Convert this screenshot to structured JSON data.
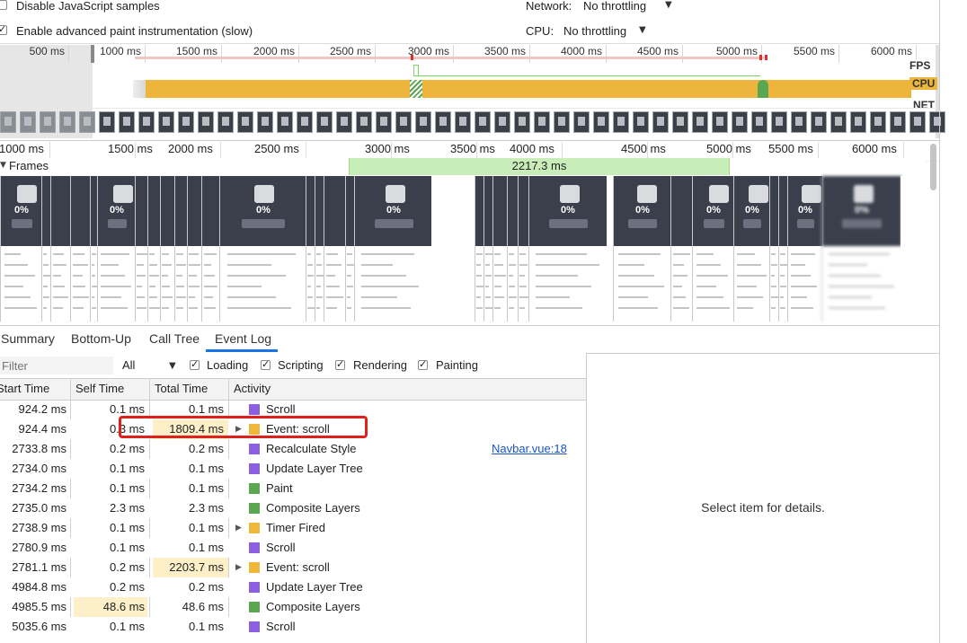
{
  "settings": {
    "disable_js_samples": {
      "label": "Disable JavaScript samples",
      "checked": false
    },
    "advanced_paint": {
      "label": "Enable advanced paint instrumentation (slow)",
      "checked": true
    },
    "network": {
      "label": "Network:",
      "value": "No throttling"
    },
    "cpu": {
      "label": "CPU:",
      "value": "No throttling"
    }
  },
  "overview": {
    "ticks": [
      "500 ms",
      "1000 ms",
      "1500 ms",
      "2000 ms",
      "2500 ms",
      "3000 ms",
      "3500 ms",
      "4000 ms",
      "4500 ms",
      "5000 ms",
      "5500 ms",
      "6000 ms"
    ],
    "track_labels": {
      "fps": "FPS",
      "cpu": "CPU",
      "net": "NET"
    }
  },
  "timeline": {
    "ticks": [
      "1000 ms",
      "1500 ms",
      "2000 ms",
      "2500 ms",
      "3000 ms",
      "3500 ms",
      "4000 ms",
      "4500 ms",
      "5000 ms",
      "5500 ms",
      "6000 ms"
    ],
    "frames_label": "Frames",
    "frame_duration": "2217.3 ms",
    "frame_percent": "0%"
  },
  "tabs": [
    {
      "label": "Summary",
      "active": false
    },
    {
      "label": "Bottom-Up",
      "active": false
    },
    {
      "label": "Call Tree",
      "active": false
    },
    {
      "label": "Event Log",
      "active": true
    }
  ],
  "filters": {
    "filter_placeholder": "Filter",
    "select_value": "All",
    "checks": [
      {
        "label": "Loading",
        "checked": true
      },
      {
        "label": "Scripting",
        "checked": true
      },
      {
        "label": "Rendering",
        "checked": true
      },
      {
        "label": "Painting",
        "checked": true
      }
    ]
  },
  "table": {
    "headers": [
      "Start Time",
      "Self Time",
      "Total Time",
      "Activity"
    ],
    "rows": [
      {
        "start": "924.2 ms",
        "self": "0.1 ms",
        "total": "0.1 ms",
        "activity": "Scroll",
        "color": "#8b5fe0",
        "expandable": false,
        "link": "",
        "total_highlight": false,
        "self_highlight": false
      },
      {
        "start": "924.4 ms",
        "self": "0.3 ms",
        "total": "1809.4 ms",
        "activity": "Event: scroll",
        "color": "#f0b73a",
        "expandable": true,
        "link": "",
        "total_highlight": true,
        "self_highlight": false
      },
      {
        "start": "2733.8 ms",
        "self": "0.2 ms",
        "total": "0.2 ms",
        "activity": "Recalculate Style",
        "color": "#8b5fe0",
        "expandable": false,
        "link": "Navbar.vue:18",
        "total_highlight": false,
        "self_highlight": false
      },
      {
        "start": "2734.0 ms",
        "self": "0.1 ms",
        "total": "0.1 ms",
        "activity": "Update Layer Tree",
        "color": "#8b5fe0",
        "expandable": false,
        "link": "",
        "total_highlight": false,
        "self_highlight": false
      },
      {
        "start": "2734.2 ms",
        "self": "0.1 ms",
        "total": "0.1 ms",
        "activity": "Paint",
        "color": "#5aa651",
        "expandable": false,
        "link": "",
        "total_highlight": false,
        "self_highlight": false
      },
      {
        "start": "2735.0 ms",
        "self": "2.3 ms",
        "total": "2.3 ms",
        "activity": "Composite Layers",
        "color": "#5aa651",
        "expandable": false,
        "link": "",
        "total_highlight": false,
        "self_highlight": false
      },
      {
        "start": "2738.9 ms",
        "self": "0.1 ms",
        "total": "0.1 ms",
        "activity": "Timer Fired",
        "color": "#f0b73a",
        "expandable": true,
        "link": "",
        "total_highlight": false,
        "self_highlight": false
      },
      {
        "start": "2780.9 ms",
        "self": "0.1 ms",
        "total": "0.1 ms",
        "activity": "Scroll",
        "color": "#8b5fe0",
        "expandable": false,
        "link": "",
        "total_highlight": false,
        "self_highlight": false
      },
      {
        "start": "2781.1 ms",
        "self": "0.2 ms",
        "total": "2203.7 ms",
        "activity": "Event: scroll",
        "color": "#f0b73a",
        "expandable": true,
        "link": "",
        "total_highlight": true,
        "self_highlight": false
      },
      {
        "start": "4984.8 ms",
        "self": "0.2 ms",
        "total": "0.2 ms",
        "activity": "Update Layer Tree",
        "color": "#8b5fe0",
        "expandable": false,
        "link": "",
        "total_highlight": false,
        "self_highlight": false
      },
      {
        "start": "4985.5 ms",
        "self": "48.6 ms",
        "total": "48.6 ms",
        "activity": "Composite Layers",
        "color": "#5aa651",
        "expandable": false,
        "link": "",
        "total_highlight": false,
        "self_highlight": true
      },
      {
        "start": "5035.6 ms",
        "self": "0.1 ms",
        "total": "0.1 ms",
        "activity": "Scroll",
        "color": "#8b5fe0",
        "expandable": false,
        "link": "",
        "total_highlight": false,
        "self_highlight": false
      }
    ]
  },
  "details": {
    "placeholder": "Select item for details."
  },
  "colors": {
    "accent_tab": "#1a73e8",
    "highlight_box": "#e0201c",
    "cpu_bar": "#edb53c",
    "frame_green": "#c9edb9"
  }
}
